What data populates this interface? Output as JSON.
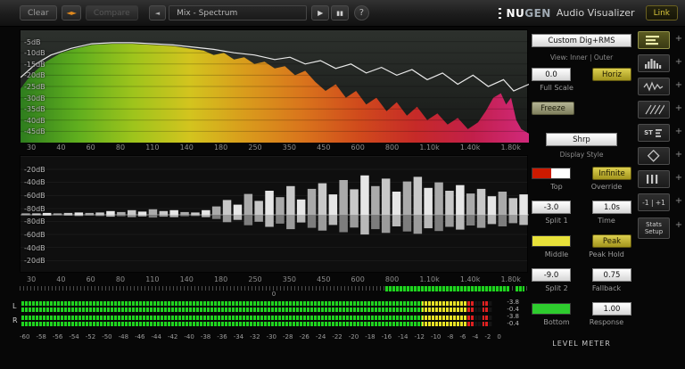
{
  "toolbar": {
    "clear": "Clear",
    "compare": "Compare",
    "preset": "Mix - Spectrum",
    "link": "Link",
    "icons": {
      "swap": "◄►",
      "prev": "◄",
      "play": "▶",
      "pause": "▮▮",
      "help": "?"
    },
    "brand": {
      "nu": "NU",
      "gen": "GEN",
      "product": "Audio Visualizer"
    }
  },
  "spectrum": {
    "db_labels": [
      "-5dB",
      "-10dB",
      "-15dB",
      "-20dB",
      "-25dB",
      "-30dB",
      "-35dB",
      "-40dB",
      "-45dB"
    ],
    "freq_labels": [
      "30",
      "40",
      "60",
      "80",
      "110",
      "140",
      "180",
      "250",
      "350",
      "450",
      "600",
      "800",
      "1.10k",
      "1.40k",
      "1.80k"
    ],
    "db_top": 0,
    "db_bottom": -50,
    "gradient": [
      "#2e7d1e",
      "#5fae1e",
      "#9ec41c",
      "#d3c41e",
      "#d99b1c",
      "#d9741c",
      "#d04a1c",
      "#c62a28",
      "#c21f4a",
      "#d1297c"
    ],
    "fill_points_db": [
      [
        0,
        -26
      ],
      [
        0.02,
        -20
      ],
      [
        0.05,
        -14
      ],
      [
        0.08,
        -10
      ],
      [
        0.11,
        -8
      ],
      [
        0.14,
        -6.5
      ],
      [
        0.18,
        -6
      ],
      [
        0.22,
        -6
      ],
      [
        0.26,
        -6.5
      ],
      [
        0.3,
        -7
      ],
      [
        0.33,
        -8
      ],
      [
        0.36,
        -9
      ],
      [
        0.38,
        -11
      ],
      [
        0.4,
        -10
      ],
      [
        0.42,
        -13
      ],
      [
        0.44,
        -12
      ],
      [
        0.46,
        -15
      ],
      [
        0.48,
        -14
      ],
      [
        0.5,
        -17
      ],
      [
        0.52,
        -16
      ],
      [
        0.54,
        -20
      ],
      [
        0.56,
        -18
      ],
      [
        0.58,
        -23
      ],
      [
        0.6,
        -27
      ],
      [
        0.62,
        -24
      ],
      [
        0.64,
        -30
      ],
      [
        0.66,
        -27
      ],
      [
        0.68,
        -33
      ],
      [
        0.7,
        -30
      ],
      [
        0.72,
        -36
      ],
      [
        0.74,
        -32
      ],
      [
        0.76,
        -38
      ],
      [
        0.78,
        -34
      ],
      [
        0.8,
        -40
      ],
      [
        0.82,
        -37
      ],
      [
        0.84,
        -42
      ],
      [
        0.86,
        -39
      ],
      [
        0.88,
        -44
      ],
      [
        0.9,
        -41
      ],
      [
        0.915,
        -36
      ],
      [
        0.93,
        -30
      ],
      [
        0.945,
        -28
      ],
      [
        0.955,
        -33
      ],
      [
        0.965,
        -30
      ],
      [
        0.975,
        -40
      ],
      [
        0.985,
        -44
      ],
      [
        1,
        -46
      ]
    ],
    "line_points_db": [
      [
        0,
        -21
      ],
      [
        0.03,
        -15
      ],
      [
        0.06,
        -11
      ],
      [
        0.1,
        -8
      ],
      [
        0.14,
        -6
      ],
      [
        0.18,
        -5.5
      ],
      [
        0.22,
        -5.5
      ],
      [
        0.26,
        -6
      ],
      [
        0.3,
        -6.5
      ],
      [
        0.34,
        -7.5
      ],
      [
        0.38,
        -8.5
      ],
      [
        0.42,
        -10
      ],
      [
        0.46,
        -11
      ],
      [
        0.5,
        -13
      ],
      [
        0.53,
        -12
      ],
      [
        0.56,
        -15
      ],
      [
        0.59,
        -13.5
      ],
      [
        0.62,
        -17
      ],
      [
        0.65,
        -15
      ],
      [
        0.68,
        -19
      ],
      [
        0.71,
        -16.5
      ],
      [
        0.74,
        -20
      ],
      [
        0.77,
        -17.5
      ],
      [
        0.8,
        -22
      ],
      [
        0.83,
        -19
      ],
      [
        0.86,
        -24
      ],
      [
        0.89,
        -20
      ],
      [
        0.92,
        -25
      ],
      [
        0.95,
        -22
      ],
      [
        0.97,
        -27
      ],
      [
        1,
        -24
      ]
    ]
  },
  "diff": {
    "db_labels": [
      "-20dB",
      "-40dB",
      "-60dB",
      "-80dB",
      "-80dB",
      "-60dB",
      "-40dB",
      "-20dB"
    ],
    "bars": [
      0.03,
      0.03,
      0.04,
      0.03,
      0.04,
      0.05,
      0.04,
      0.05,
      0.08,
      0.06,
      0.1,
      0.07,
      0.12,
      0.08,
      0.1,
      0.06,
      0.05,
      0.1,
      0.18,
      0.32,
      0.22,
      0.45,
      0.3,
      0.52,
      0.38,
      0.62,
      0.33,
      0.56,
      0.68,
      0.44,
      0.75,
      0.55,
      0.85,
      0.62,
      0.78,
      0.5,
      0.72,
      0.82,
      0.58,
      0.7,
      0.52,
      0.64,
      0.46,
      0.56,
      0.4,
      0.5,
      0.36,
      0.44
    ]
  },
  "ruler": {
    "zero": "0"
  },
  "meter": {
    "channels": [
      {
        "label": "L",
        "readouts": [
          "-3.8",
          "-0.4"
        ],
        "green": 85,
        "yellow": 94.5,
        "red": 96.3,
        "peak": 98,
        "peakw": 1.3
      },
      {
        "label": "R",
        "readouts": [
          "-3.8",
          "-0.4"
        ],
        "green": 85,
        "yellow": 94.5,
        "red": 96.3,
        "peak": 98,
        "peakw": 1.3
      }
    ],
    "scale": [
      "-60",
      "-58",
      "-56",
      "-54",
      "-52",
      "-50",
      "-48",
      "-46",
      "-44",
      "-42",
      "-40",
      "-38",
      "-36",
      "-34",
      "-32",
      "-30",
      "-28",
      "-26",
      "-24",
      "-22",
      "-20",
      "-18",
      "-16",
      "-14",
      "-12",
      "-10",
      "-8",
      "-6",
      "-4",
      "-2",
      "0"
    ],
    "colors": {
      "green": "#1fd41f",
      "yellow": "#e8e225",
      "red": "#e02020"
    }
  },
  "panel": {
    "preset": "Custom Dig+RMS",
    "view_mode": "View: Inner | Outer",
    "full_scale_value": "0.0",
    "horiz": "Horiz",
    "full_scale_label": "Full Scale",
    "freeze": "Freeze",
    "display_style_value": "Shrp",
    "display_style_label": "Display Style",
    "infinite": "Infinite",
    "top_label": "Top",
    "override_label": "Override",
    "split1_value": "-3.0",
    "time_value": "1.0s",
    "split1_label": "Split 1",
    "time_label": "Time",
    "peak": "Peak",
    "middle_label": "Middle",
    "peak_hold_label": "Peak Hold",
    "split2_value": "-9.0",
    "fallback_value": "0.75",
    "split2_label": "Split 2",
    "fallback_label": "Fallback",
    "response_value": "1.00",
    "bottom_label": "Bottom",
    "response_label": "Response",
    "level_meter_title": "LEVEL METER",
    "swatches": {
      "top_left": "#cc1a00",
      "top_right": "#ffffff",
      "middle": "#e8e13a",
      "bottom": "#2ecc2e"
    }
  },
  "side": {
    "plus": "+",
    "buttons": [
      {
        "icon": "meter-lines",
        "active": true
      },
      {
        "icon": "histogram"
      },
      {
        "icon": "waveform"
      },
      {
        "icon": "hatch"
      },
      {
        "icon": "stereo",
        "label": "ST"
      },
      {
        "icon": "diamond"
      },
      {
        "icon": "vbars"
      },
      {
        "icon": "nav",
        "label": "-1 | +1"
      },
      {
        "icon": "stats",
        "label": "Stats Setup"
      }
    ]
  }
}
